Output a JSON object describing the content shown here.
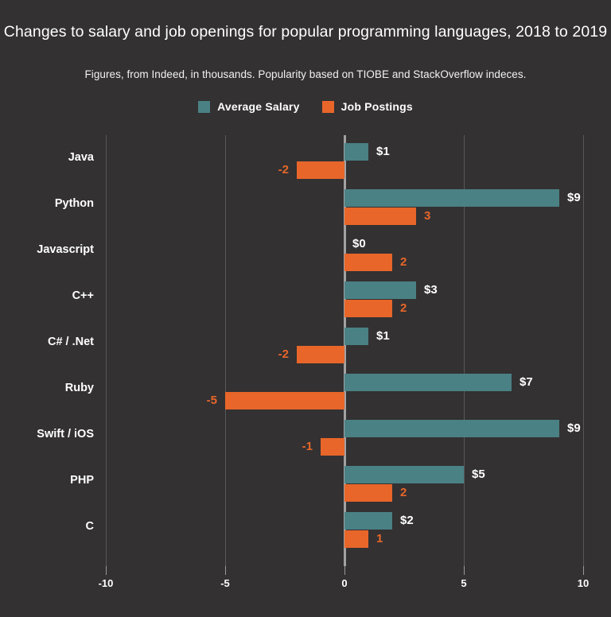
{
  "header": {
    "title": "Changes to salary and job openings for popular programming languages, 2018 to 2019",
    "subtitle": "Figures, from Indeed, in thousands. Popularity based on TIOBE and StackOverflow indeces."
  },
  "legend": {
    "position": "top-center",
    "items": [
      {
        "label": "Average Salary",
        "color": "#4a8184"
      },
      {
        "label": "Job Postings",
        "color": "#e8662a"
      }
    ]
  },
  "colors": {
    "background": "#333132",
    "salary": "#4a8184",
    "postings": "#e8662a",
    "text": "#ffffff",
    "gridline": "#58585a",
    "zeroline": "#a2a2a3"
  },
  "chart_data": {
    "type": "bar",
    "orientation": "horizontal",
    "title": "Changes to salary and job openings for popular programming languages, 2018 to 2019",
    "subtitle": "Figures, from Indeed, in thousands. Popularity based on TIOBE and StackOverflow indeces.",
    "xlabel": "",
    "ylabel": "",
    "xlim": [
      -10,
      10
    ],
    "xticks": [
      -10,
      -5,
      0,
      5,
      10
    ],
    "xtick_labels": [
      "-10",
      "-5",
      "0",
      "5",
      "10"
    ],
    "grid": true,
    "categories": [
      "Java",
      "Python",
      "Javascript",
      "C++",
      "C# / .Net",
      "Ruby",
      "Swift / iOS",
      "PHP",
      "C"
    ],
    "series": [
      {
        "name": "Average Salary",
        "color": "#4a8184",
        "values": [
          1,
          9,
          0,
          3,
          1,
          7,
          9,
          5,
          2
        ],
        "data_labels": [
          "$1",
          "$9",
          "$0",
          "$3",
          "$1",
          "$7",
          "$9",
          "$5",
          "$2"
        ]
      },
      {
        "name": "Job Postings",
        "color": "#e8662a",
        "values": [
          -2,
          3,
          2,
          2,
          -2,
          -5,
          -1,
          2,
          1
        ],
        "data_labels": [
          "-2",
          "3",
          "2",
          "2",
          "-2",
          "-5",
          "-1",
          "2",
          "1"
        ]
      }
    ]
  }
}
